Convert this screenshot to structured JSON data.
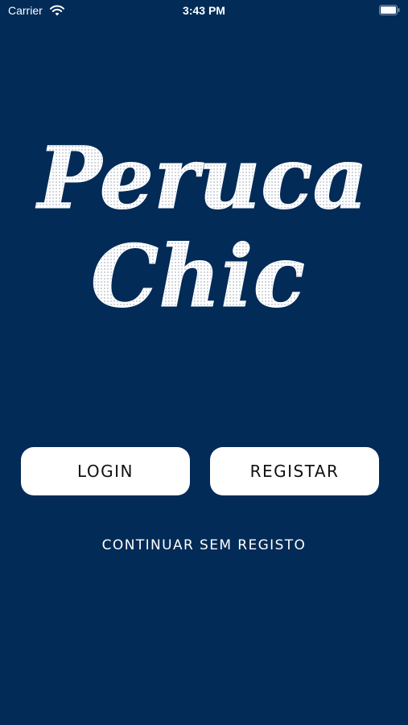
{
  "status_bar": {
    "carrier": "Carrier",
    "time": "3:43 PM",
    "icons": [
      "wifi-icon",
      "battery-icon"
    ]
  },
  "logo": {
    "line1": "Peruca",
    "line2": "Chic"
  },
  "buttons": {
    "login_label": "LOGIN",
    "register_label": "REGISTAR"
  },
  "links": {
    "continue_label": "CONTINUAR SEM REGISTO"
  },
  "colors": {
    "background": "#022B57",
    "button_bg": "#FFFFFF",
    "button_text": "#111111",
    "text": "#FFFFFF"
  }
}
